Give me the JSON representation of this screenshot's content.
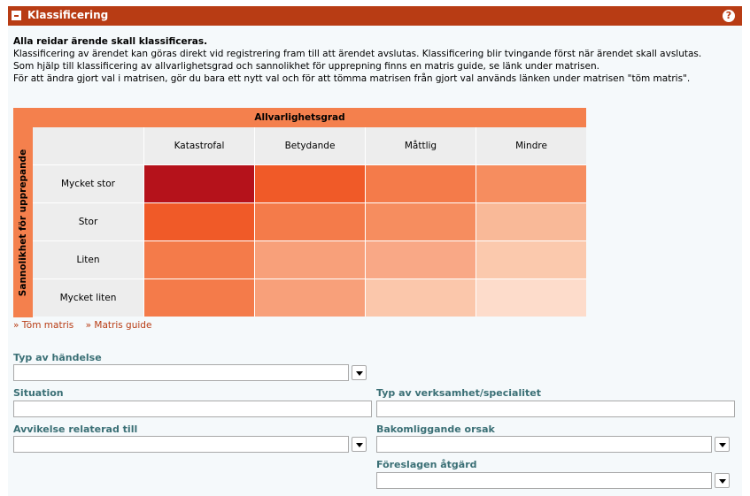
{
  "header": {
    "title": "Klassificering",
    "help_symbol": "?"
  },
  "intro": {
    "bold_line": "Alla reidar ärende skall klassificeras.",
    "lines": [
      "Klassificering av ärendet kan göras direkt vid registrering fram till att ärendet avslutas. Klassificering blir tvingande först när ärendet skall avslutas.",
      "Som hjälp till klassificering av allvarlighetsgrad och sannolikhet för upprepning finns en matris guide, se länk under matrisen.",
      "För att ändra gjort val i matrisen, gör du bara ett nytt val och för att tömma matrisen från gjort val används länken under matrisen \"töm matris\"."
    ]
  },
  "matrix": {
    "top_label": "Allvarlighetsgrad",
    "side_label": "Sannolikhet för upprepande",
    "columns": [
      "Katastrofal",
      "Betydande",
      "Måttlig",
      "Mindre"
    ],
    "rows": [
      {
        "label": "Mycket stor",
        "colors": [
          "#b5121b",
          "#f05a28",
          "#f47b4a",
          "#f68d5f"
        ]
      },
      {
        "label": "Stor",
        "colors": [
          "#f05a28",
          "#f47b4a",
          "#f68d5f",
          "#f9b998"
        ]
      },
      {
        "label": "Liten",
        "colors": [
          "#f47b4a",
          "#f8a07a",
          "#f9a886",
          "#fbc9ad"
        ]
      },
      {
        "label": "Mycket liten",
        "colors": [
          "#f47b4a",
          "#f8a07a",
          "#fbc7ab",
          "#fddccb"
        ]
      }
    ]
  },
  "links": {
    "clear": "» Töm matris",
    "guide": "» Matris guide"
  },
  "fields": {
    "typ_av_handelse": {
      "label": "Typ av händelse",
      "value": ""
    },
    "situation": {
      "label": "Situation",
      "value": ""
    },
    "typ_av_verksamhet": {
      "label": "Typ av verksamhet/specialitet",
      "value": ""
    },
    "avvikelse": {
      "label": "Avvikelse relaterad till",
      "value": ""
    },
    "bakomliggande": {
      "label": "Bakomliggande orsak",
      "value": ""
    },
    "foreslagen": {
      "label": "Föreslagen åtgärd",
      "value": ""
    }
  }
}
